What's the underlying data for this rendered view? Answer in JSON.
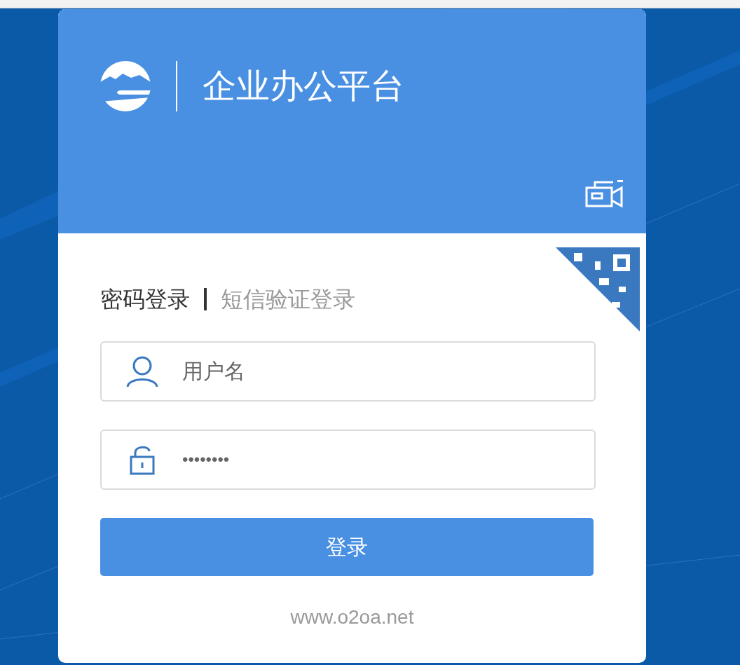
{
  "header": {
    "title": "企业办公平台"
  },
  "tabs": [
    {
      "label": "密码登录",
      "selected": true
    },
    {
      "label": "短信验证登录",
      "selected": false
    }
  ],
  "username": {
    "placeholder": "用户名"
  },
  "password": {
    "value": "••••••••"
  },
  "login_button": "登录",
  "footer_link": "www.o2oa.net"
}
